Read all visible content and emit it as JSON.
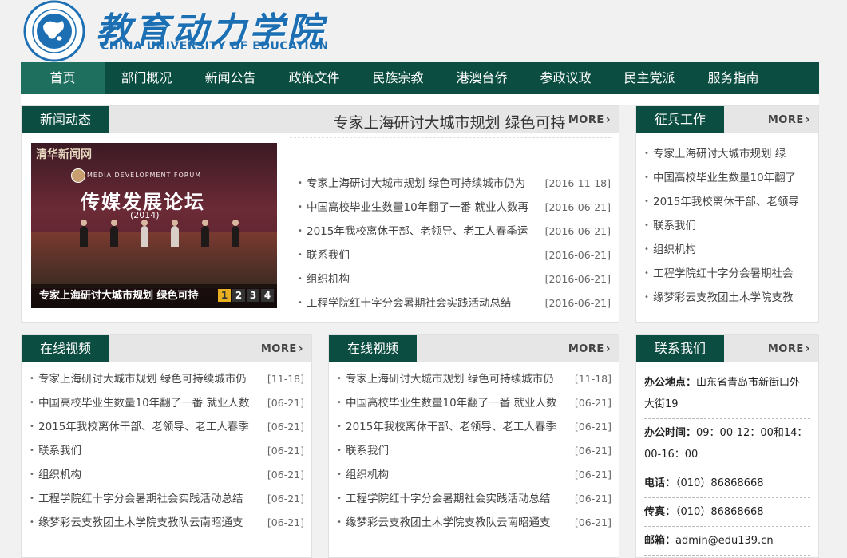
{
  "site": {
    "name_cn": "教育动力学院",
    "name_en": "CHINA UNIVERSITY OF EDUCATION",
    "seal_en": "CHINA UNIVERSITY OF EDUCATION"
  },
  "nav": {
    "items": [
      "首页",
      "部门概况",
      "新闻公告",
      "政策文件",
      "民族宗教",
      "港澳台侨",
      "参政议政",
      "民主党派",
      "服务指南"
    ],
    "active_index": 0
  },
  "colors": {
    "brand_green": "#0b4d41",
    "nav_active": "#1f6f5f",
    "logo_blue": "#1c6fb3",
    "pager_active": "#e8b020"
  },
  "more_label": "MORE",
  "news": {
    "title": "新闻动态",
    "headline": "专家上海研讨大城市规划 绿色可持",
    "feature": {
      "watermark": "清华新闻网",
      "forum_en": "MEDIA DEVELOPMENT FORUM",
      "forum_cn": "传媒发展论坛",
      "forum_year": "(2014)",
      "caption": "专家上海研讨大城市规划 绿色可持",
      "pages": [
        "1",
        "2",
        "3",
        "4"
      ],
      "active_page": 0
    },
    "items": [
      {
        "text": "专家上海研讨大城市规划 绿色可持续城市仍为",
        "date": "[2016-11-18]"
      },
      {
        "text": "中国高校毕业生数量10年翻了一番 就业人数再",
        "date": "[2016-06-21]"
      },
      {
        "text": "2015年我校离休干部、老领导、老工人春季运",
        "date": "[2016-06-21]"
      },
      {
        "text": "联系我们",
        "date": "[2016-06-21]"
      },
      {
        "text": "组织机构",
        "date": "[2016-06-21]"
      },
      {
        "text": "工程学院红十字分会暑期社会实践活动总结",
        "date": "[2016-06-21]"
      }
    ]
  },
  "recruit": {
    "title": "征兵工作",
    "items": [
      "专家上海研讨大城市规划 绿",
      "中国高校毕业生数量10年翻了",
      "2015年我校离休干部、老领导",
      "联系我们",
      "组织机构",
      "工程学院红十字分会暑期社会",
      "缘梦彩云支教团土木学院支教"
    ]
  },
  "video1": {
    "title": "在线视频",
    "items": [
      {
        "text": "专家上海研讨大城市规划 绿色可持续城市仍",
        "date": "[11-18]"
      },
      {
        "text": "中国高校毕业生数量10年翻了一番 就业人数",
        "date": "[06-21]"
      },
      {
        "text": "2015年我校离休干部、老领导、老工人春季",
        "date": "[06-21]"
      },
      {
        "text": "联系我们",
        "date": "[06-21]"
      },
      {
        "text": "组织机构",
        "date": "[06-21]"
      },
      {
        "text": "工程学院红十字分会暑期社会实践活动总结",
        "date": "[06-21]"
      },
      {
        "text": "缘梦彩云支教团土木学院支教队云南昭通支",
        "date": "[06-21]"
      }
    ]
  },
  "video2": {
    "title": "在线视频",
    "items": [
      {
        "text": "专家上海研讨大城市规划 绿色可持续城市仍",
        "date": "[11-18]"
      },
      {
        "text": "中国高校毕业生数量10年翻了一番 就业人数",
        "date": "[06-21]"
      },
      {
        "text": "2015年我校离休干部、老领导、老工人春季",
        "date": "[06-21]"
      },
      {
        "text": "联系我们",
        "date": "[06-21]"
      },
      {
        "text": "组织机构",
        "date": "[06-21]"
      },
      {
        "text": "工程学院红十字分会暑期社会实践活动总结",
        "date": "[06-21]"
      },
      {
        "text": "缘梦彩云支教团土木学院支教队云南昭通支",
        "date": "[06-21]"
      }
    ]
  },
  "contact": {
    "title": "联系我们",
    "rows": [
      {
        "label": "办公地点：",
        "value": "山东省青岛市新街口外大街19"
      },
      {
        "label": "办公时间：",
        "value": "09：00-12：00和14：00-16：00"
      },
      {
        "label": "电话：",
        "value": "（010）86868668"
      },
      {
        "label": "传真：",
        "value": "（010）86868668"
      },
      {
        "label": "邮箱：",
        "value": "admin@edu139.cn"
      }
    ]
  }
}
